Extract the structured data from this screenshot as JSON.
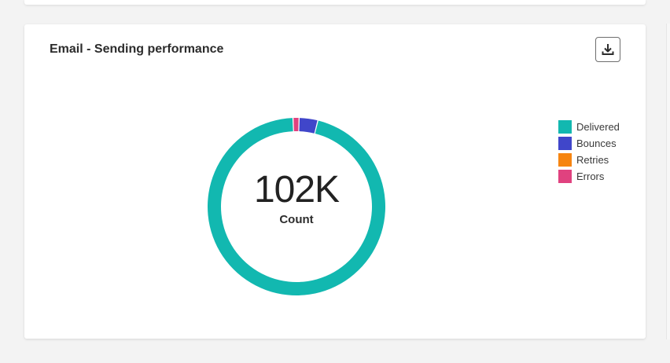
{
  "card": {
    "title": "Email - Sending performance",
    "download_icon": "download-icon"
  },
  "summary": {
    "value": "102K",
    "label": "Count"
  },
  "colors": {
    "Delivered": "#12b8b0",
    "Bounces": "#4046ca",
    "Retries": "#f68511",
    "Errors": "#e0427f"
  },
  "chart_data": {
    "type": "pie",
    "categories": [
      "Delivered",
      "Bounces",
      "Retries",
      "Errors"
    ],
    "values": [
      0.955,
      0.034,
      0.0,
      0.011
    ],
    "legend_position": "right",
    "legend": [
      {
        "label": "Delivered",
        "color": "#12b8b0"
      },
      {
        "label": "Bounces",
        "color": "#4046ca"
      },
      {
        "label": "Retries",
        "color": "#f68511"
      },
      {
        "label": "Errors",
        "color": "#e0427f"
      }
    ]
  }
}
